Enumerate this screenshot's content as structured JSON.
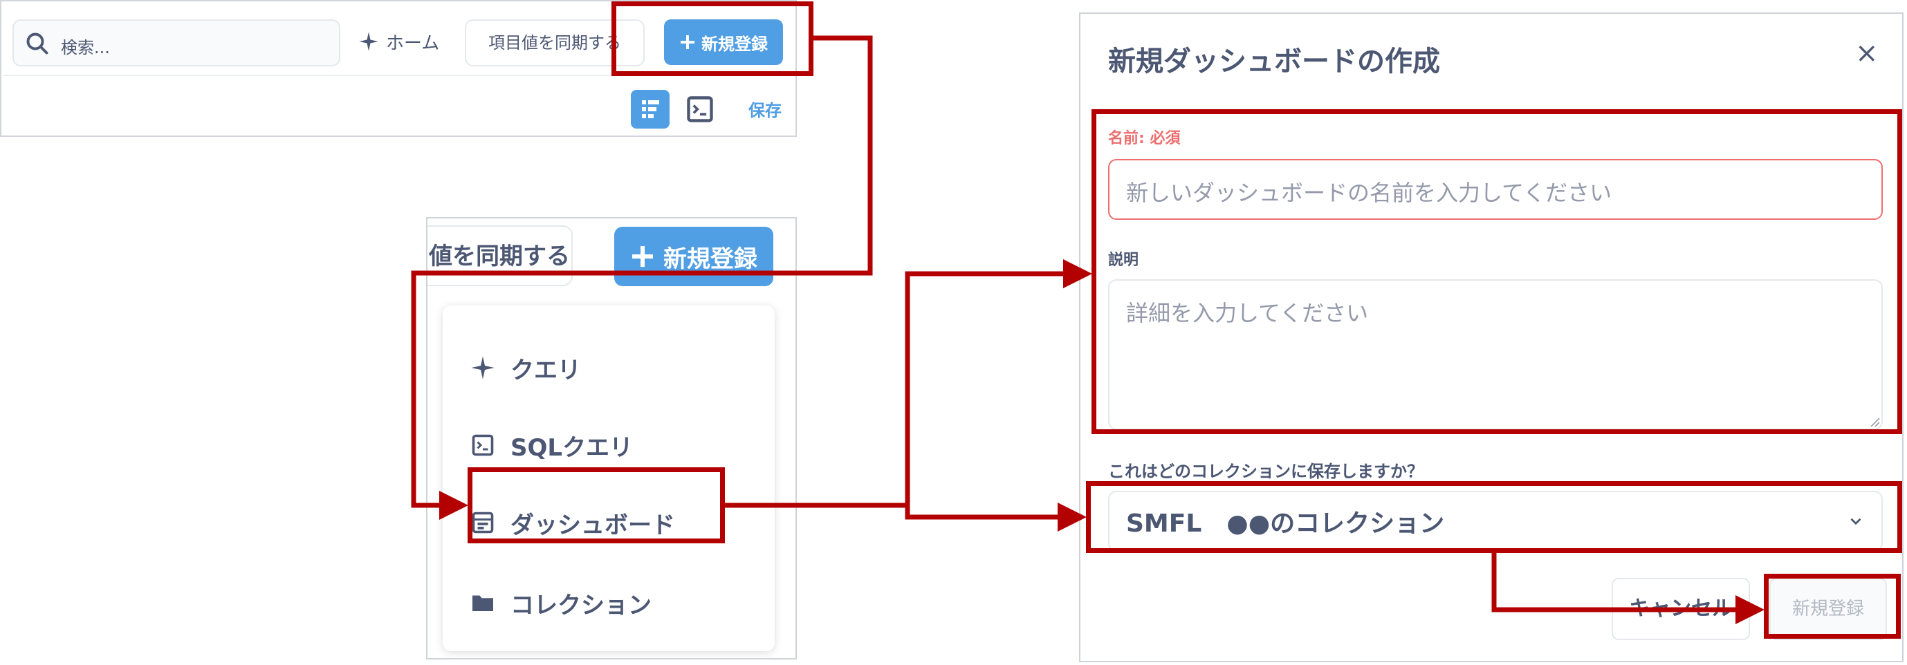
{
  "toolbar": {
    "search_placeholder": "検索...",
    "home_label": "ホーム",
    "sync_label": "項目値を同期する",
    "new_label": "新規登録",
    "save_label": "保存"
  },
  "dropdown": {
    "sync_label": "値を同期する",
    "new_label": "新規登録",
    "items": [
      {
        "label": "クエリ",
        "icon": "sparkle-icon"
      },
      {
        "label": "SQLクエリ",
        "icon": "terminal-icon"
      },
      {
        "label": "ダッシュボード",
        "icon": "dashboard-icon"
      },
      {
        "label": "コレクション",
        "icon": "folder-icon"
      }
    ]
  },
  "modal": {
    "title": "新規ダッシュボードの作成",
    "close_glyph": "×",
    "name_label": "名前: 必須",
    "name_placeholder": "新しいダッシュボードの名前を入力してください",
    "desc_label": "説明",
    "desc_placeholder": "詳細を入力してください",
    "collection_label": "これはどのコレクションに保存しますか？",
    "collection_value": "SMFL　●●のコレクション",
    "cancel_label": "キャンセル",
    "create_label": "新規登録"
  },
  "colors": {
    "accent": "#509ee3",
    "highlight": "#b30000",
    "error": "#ed6e6e",
    "text": "#4c5773"
  }
}
